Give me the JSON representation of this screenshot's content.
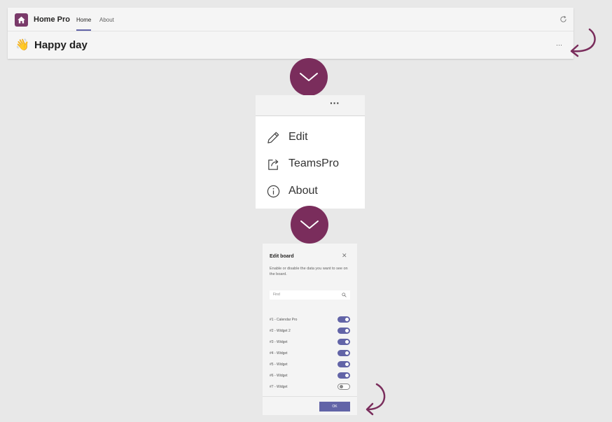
{
  "app": {
    "name": "Home Pro",
    "tabs": [
      {
        "label": "Home",
        "active": true
      },
      {
        "label": "About",
        "active": false
      }
    ]
  },
  "titlebar": {
    "emoji": "👋",
    "title": "Happy day",
    "more": "···"
  },
  "menu": {
    "dots": "···",
    "items": [
      {
        "label": "Edit",
        "icon": "pencil-icon"
      },
      {
        "label": "TeamsPro",
        "icon": "share-icon"
      },
      {
        "label": "About",
        "icon": "info-icon"
      }
    ]
  },
  "dialog": {
    "title": "Edit board",
    "close": "✕",
    "description": "Enable or disable the data you want to see on the board.",
    "search_placeholder": "Find",
    "rows": [
      {
        "label": "#1 - Calendar Pro",
        "enabled": true
      },
      {
        "label": "#2 - Widget 2",
        "enabled": true
      },
      {
        "label": "#3 - Widget",
        "enabled": true
      },
      {
        "label": "#4 - Widget",
        "enabled": true
      },
      {
        "label": "#5 - Widget",
        "enabled": true
      },
      {
        "label": "#6 - Widget",
        "enabled": true
      },
      {
        "label": "#7 - Widget",
        "enabled": false
      }
    ],
    "ok_label": "OK"
  },
  "colors": {
    "accent": "#6264a7",
    "connector": "#7a2d5c",
    "app_icon": "#7a3a6a"
  }
}
